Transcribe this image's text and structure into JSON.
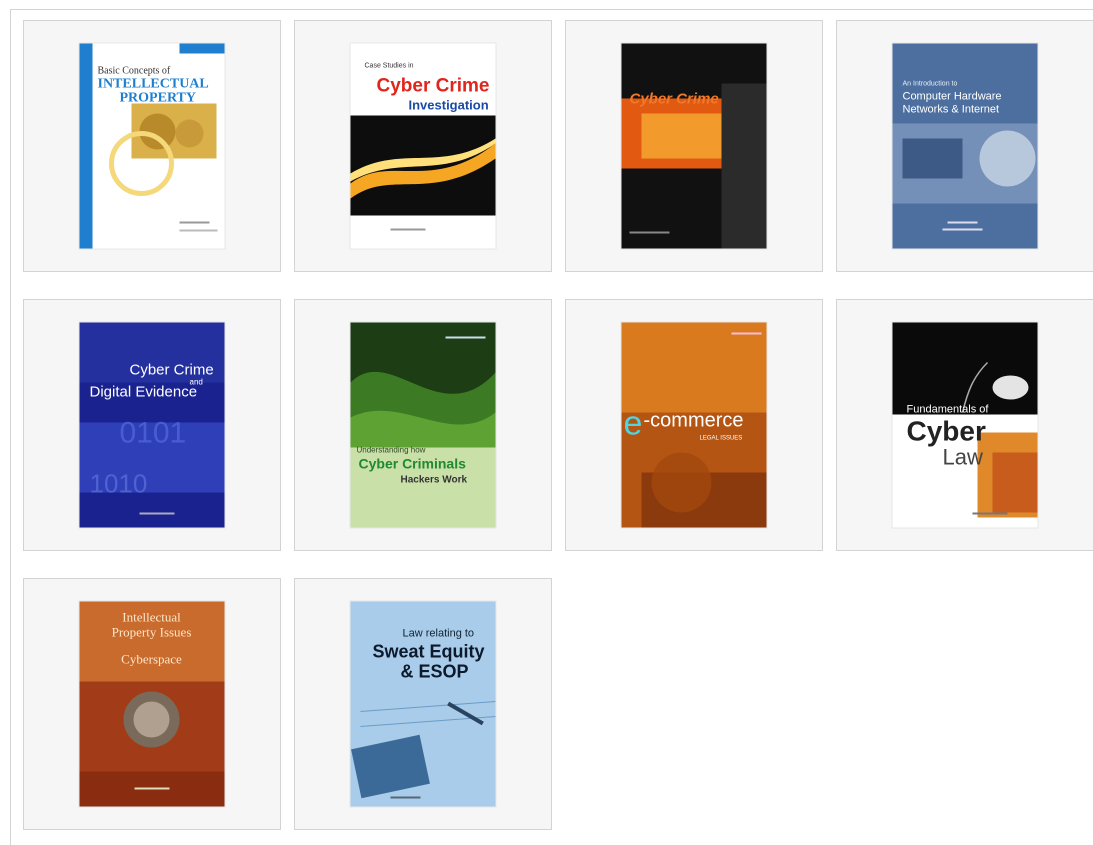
{
  "books": [
    {
      "title_lines": [
        "Basic Concepts of",
        "INTELLECTUAL",
        "PROPERTY"
      ]
    },
    {
      "title_lines": [
        "Case Studies in",
        "Cyber Crime",
        "Investigation"
      ]
    },
    {
      "title_lines": [
        "Cyber Crime"
      ]
    },
    {
      "title_lines": [
        "An Introduction to",
        "Computer Hardware",
        "Networks & Internet"
      ]
    },
    {
      "title_lines": [
        "Cyber Crime",
        "and",
        "Digital Evidence"
      ]
    },
    {
      "title_lines": [
        "Understanding how",
        "Cyber Criminals",
        "Hackers Work"
      ]
    },
    {
      "title_lines": [
        "e",
        "-commerce",
        "LEGAL ISSUES"
      ]
    },
    {
      "title_lines": [
        "Fundamentals of",
        "Cyber",
        "Law"
      ]
    },
    {
      "title_lines": [
        "Intellectual",
        "Property Issues",
        "Cyberspace"
      ]
    },
    {
      "title_lines": [
        "Law relating to",
        "Sweat Equity",
        "& ESOP"
      ]
    }
  ]
}
